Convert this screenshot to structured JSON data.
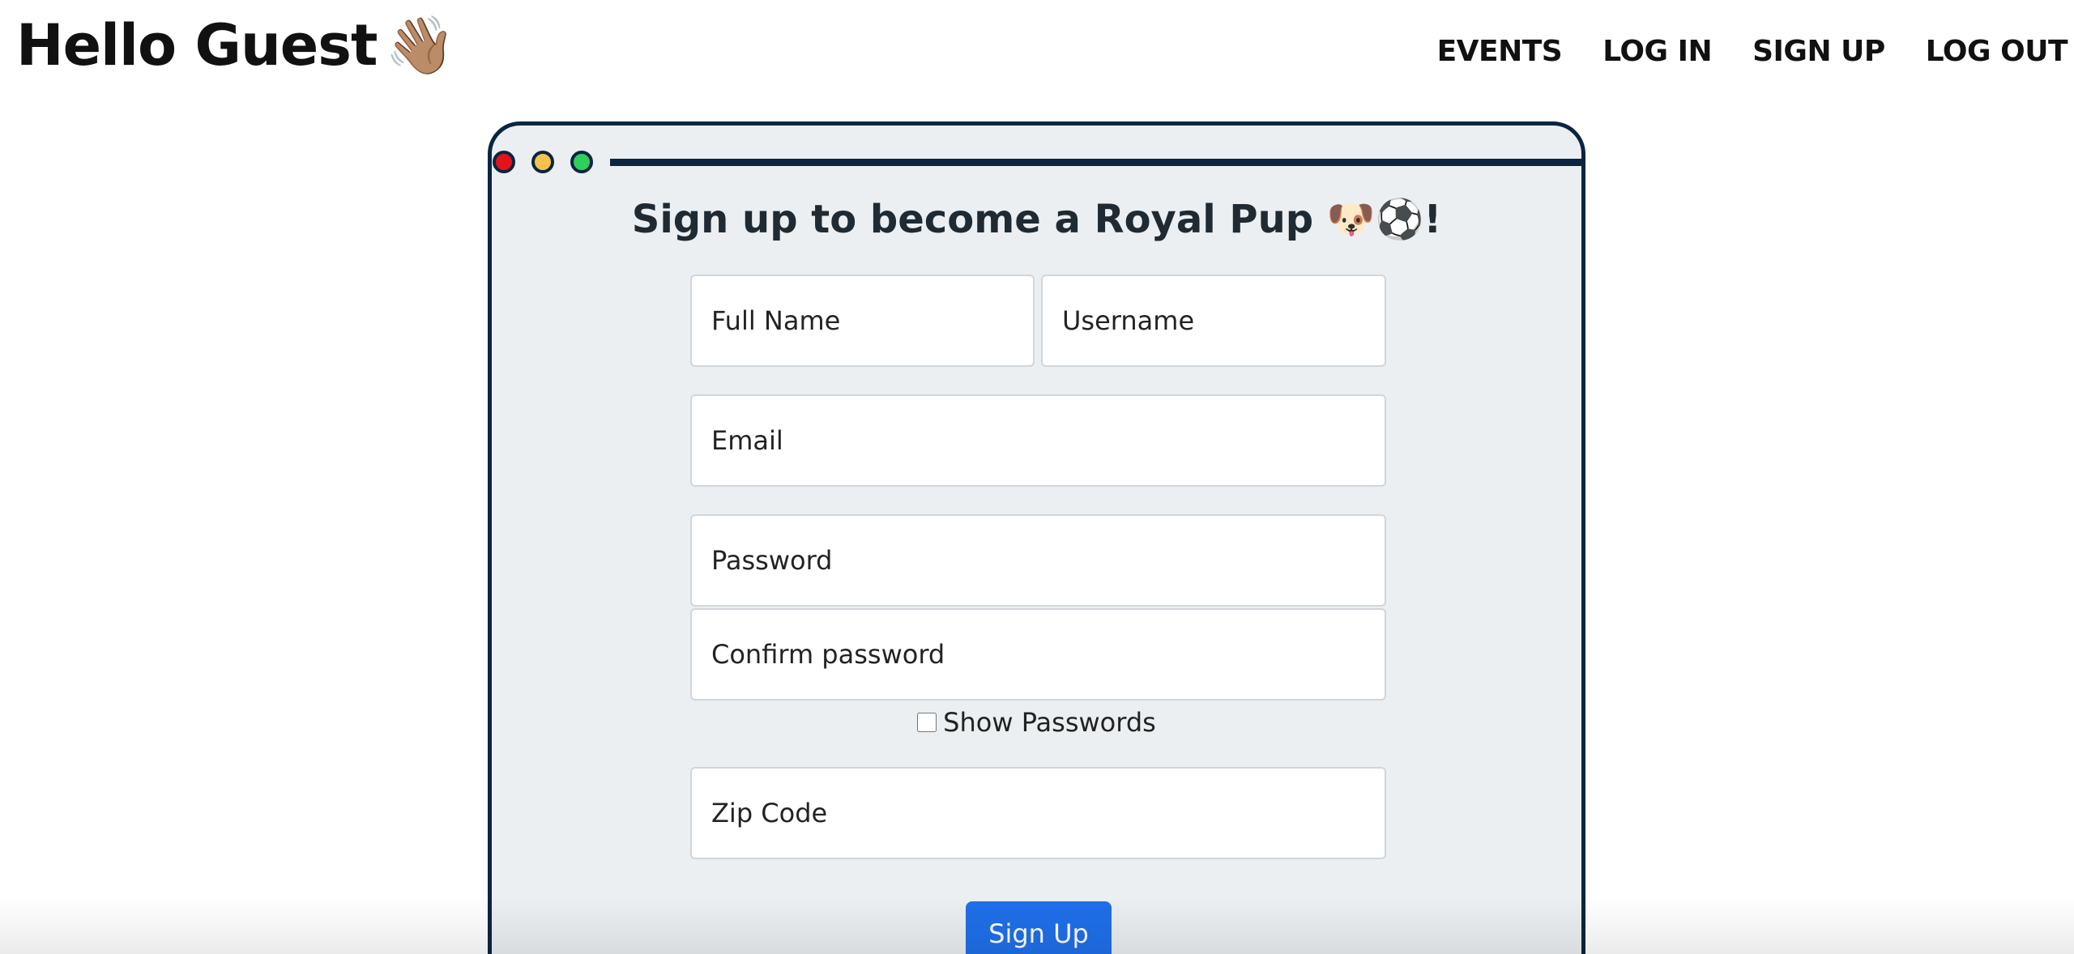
{
  "header": {
    "greeting": "Hello Guest",
    "greeting_emoji": "👋🏽",
    "nav": {
      "events": "EVENTS",
      "log_in": "LOG IN",
      "sign_up": "SIGN UP",
      "log_out": "LOG OUT"
    }
  },
  "window_controls": {
    "colors": {
      "close": "#e3131d",
      "minimize": "#f5c24e",
      "maximize": "#2ecf5d",
      "frame": "#0b2541"
    }
  },
  "form": {
    "title": "Sign up to become a Royal Pup 🐶⚽!",
    "full_name_placeholder": "Full Name",
    "username_placeholder": "Username",
    "email_placeholder": "Email",
    "password_placeholder": "Password",
    "confirm_password_placeholder": "Confirm password",
    "show_passwords_label": "Show Passwords",
    "zip_code_placeholder": "Zip Code",
    "submit_label": "Sign Up"
  },
  "colors": {
    "card_background": "#ebeff1",
    "accent": "#1f6fea"
  }
}
